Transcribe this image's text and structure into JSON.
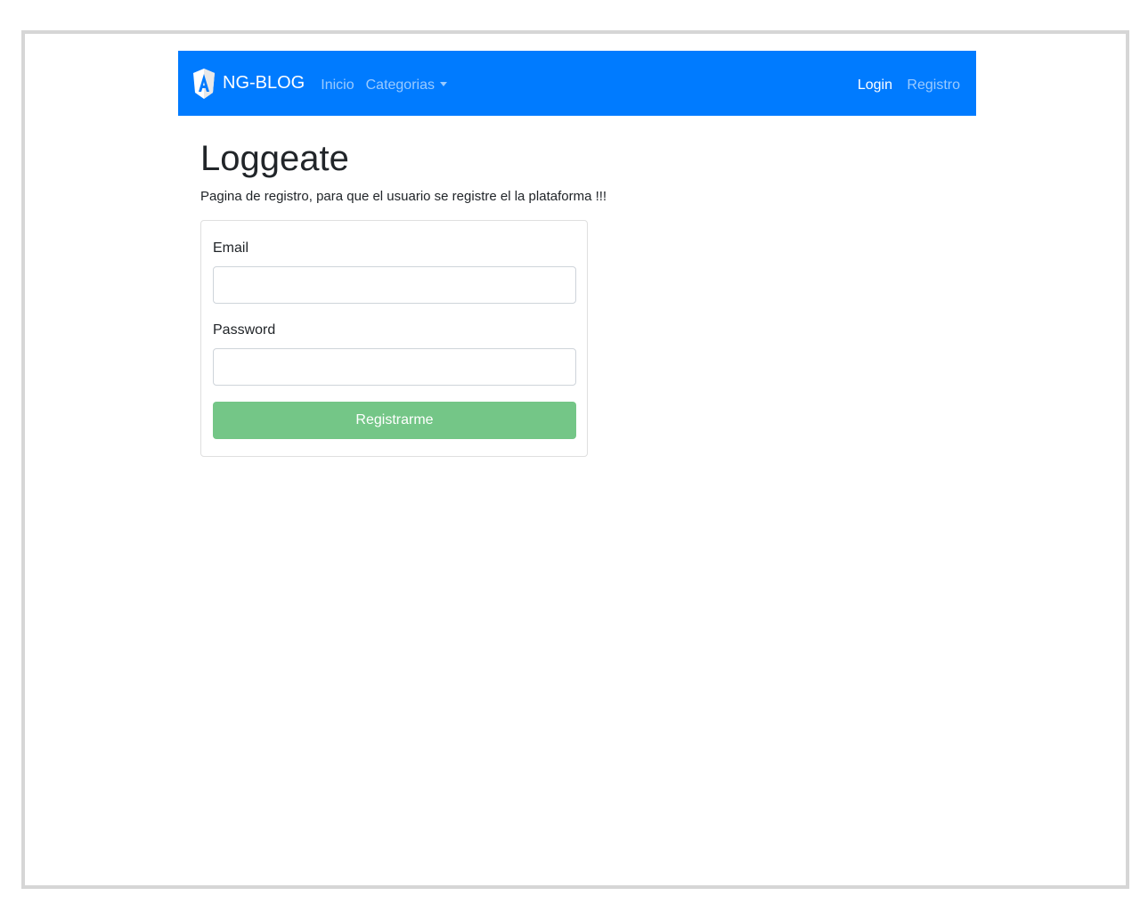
{
  "navbar": {
    "brand": "NG-BLOG",
    "links": {
      "home": "Inicio",
      "categories": "Categorias"
    },
    "right": {
      "login": "Login",
      "register": "Registro"
    },
    "brand_color": "#007bff"
  },
  "page": {
    "title": "Loggeate",
    "description": "Pagina de registro, para que el usuario se registre el la plataforma !!!"
  },
  "form": {
    "email_label": "Email",
    "email_value": "",
    "password_label": "Password",
    "password_value": "",
    "submit_label": "Registrarme",
    "submit_color": "#74c687"
  },
  "icons": {
    "brand_logo": "angular-logo-icon",
    "dropdown": "caret-down-icon"
  }
}
